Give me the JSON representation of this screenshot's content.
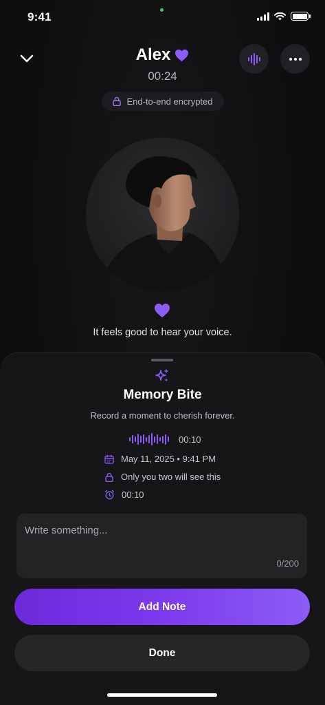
{
  "status_bar": {
    "time": "9:41"
  },
  "header": {
    "name": "Alex",
    "timer": "00:24",
    "encryption_label": "End-to-end encrypted"
  },
  "call": {
    "message": "It feels good to hear your voice."
  },
  "sheet": {
    "title": "Memory Bite",
    "subtitle": "Record a moment to cherish forever.",
    "recording_duration": "00:10",
    "date": "May 11, 2025 • 9:41 PM",
    "privacy": "Only you two will see this",
    "timer": "00:10",
    "note_placeholder": "Write something...",
    "char_counter": "0/200",
    "add_note_label": "Add Note",
    "done_label": "Done"
  },
  "colors": {
    "accent": "#8b5cf6",
    "accent_dark": "#6d28d9",
    "background": "#0d0d0f",
    "sheet": "#161618"
  },
  "icons": {
    "collapse": "chevron-down-icon",
    "voice": "waveform-icon",
    "more": "more-horizontal-icon",
    "lock": "lock-icon",
    "heart": "heart-icon",
    "sparkle": "sparkle-icon",
    "calendar": "calendar-icon",
    "alarm": "alarm-clock-icon"
  }
}
